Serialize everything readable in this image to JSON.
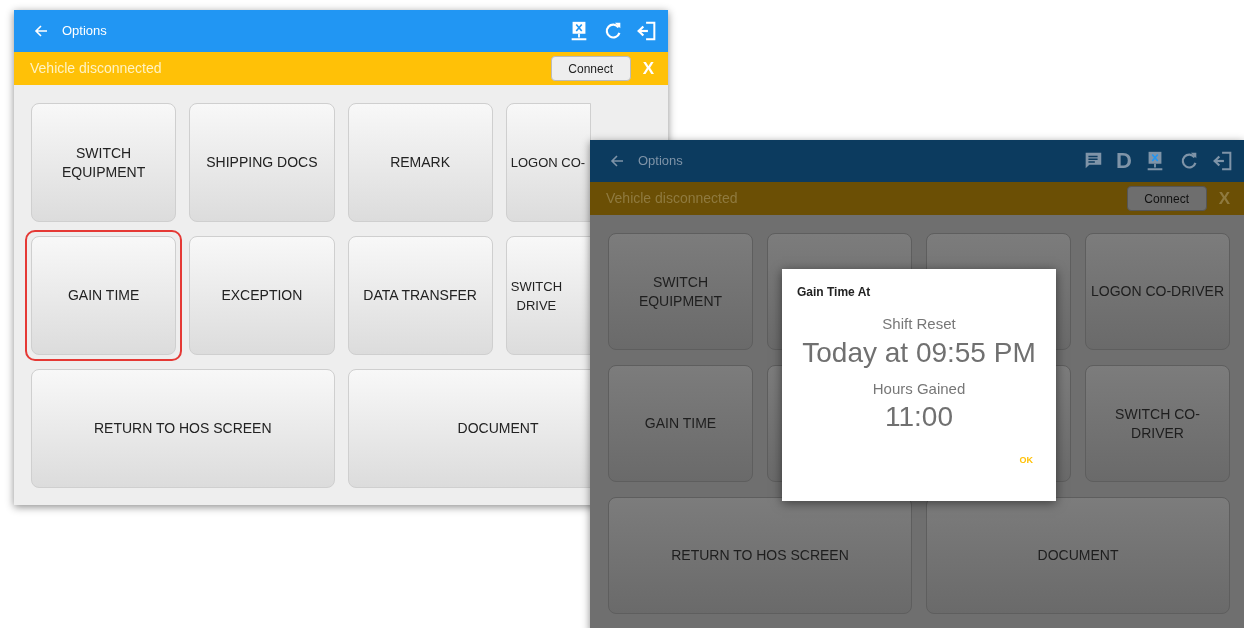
{
  "screens": [
    {
      "title": "Options",
      "dimmed": false,
      "toolbar_icons": [
        {
          "kind": "disconnected"
        },
        {
          "kind": "refresh"
        },
        {
          "kind": "logout"
        }
      ],
      "banner": {
        "text": "Vehicle disconnected",
        "button": "Connect",
        "close": "X"
      },
      "buttons": [
        {
          "label": "SWITCH\nEQUIPMENT",
          "highlighted": false
        },
        {
          "label": "SHIPPING DOCS",
          "highlighted": false
        },
        {
          "label": "REMARK",
          "highlighted": false
        },
        {
          "label": "LOGON CO-",
          "highlighted": false
        },
        {
          "label": "GAIN TIME",
          "highlighted": true
        },
        {
          "label": "EXCEPTION",
          "highlighted": false
        },
        {
          "label": "DATA TRANSFER",
          "highlighted": false
        },
        {
          "label": "SWITCH\nDRIVE",
          "highlighted": false
        },
        {
          "label": "RETURN TO HOS SCREEN",
          "highlighted": false
        },
        {
          "label": "DOCUMENT",
          "highlighted": false
        }
      ]
    },
    {
      "title": "Options",
      "dimmed": true,
      "toolbar_icons": [
        {
          "kind": "message"
        },
        {
          "kind": "letter",
          "glyph": "D"
        },
        {
          "kind": "disconnected"
        },
        {
          "kind": "refresh"
        },
        {
          "kind": "logout"
        }
      ],
      "banner": {
        "text": "Vehicle disconnected",
        "button": "Connect",
        "close": "X"
      },
      "buttons": [
        {
          "label": "SWITCH\nEQUIPMENT",
          "highlighted": false
        },
        {
          "highlighted": false
        },
        {
          "highlighted": false
        },
        {
          "label": "LOGON CO-DRIVER",
          "highlighted": false
        },
        {
          "label": "GAIN TIME",
          "highlighted": false
        },
        {
          "highlighted": false
        },
        {
          "highlighted": false
        },
        {
          "label": "SWITCH CO-\nDRIVER",
          "highlighted": false
        },
        {
          "label": "RETURN TO HOS SCREEN",
          "highlighted": false
        },
        {
          "label": "DOCUMENT",
          "highlighted": false
        }
      ],
      "dialog": {
        "title": "Gain Time At",
        "label_1": "Shift Reset",
        "value_1": "Today at 09:55 PM",
        "label_2": "Hours Gained",
        "value_2": "11:00",
        "ok": "OK"
      }
    }
  ]
}
